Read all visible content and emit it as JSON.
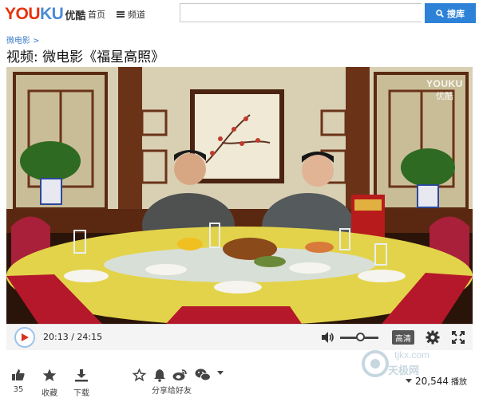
{
  "header": {
    "logo_en_part1": "YOU",
    "logo_en_part2": "KU",
    "logo_cn": "优酷",
    "nav_home": "首页",
    "nav_channel": "频道",
    "search_placeholder": "",
    "search_button": "搜库"
  },
  "breadcrumb": "微电影 >",
  "page_title": "视频: 微电影《福星高照》",
  "player": {
    "watermark_en": "YOUKU",
    "watermark_cn": "优酷",
    "time_current": "20:13",
    "time_total": "24:15",
    "time_display": "20:13 / 24:15",
    "progress": 0.834,
    "volume_level": 0.5,
    "hd_label": "高清"
  },
  "actions": {
    "like_count": "35",
    "collect_label": "收藏",
    "download_label": "下载",
    "share_label": "分享给好友",
    "view_count": "20,544",
    "view_label": "播放"
  },
  "site_watermark": {
    "line1": "tjkx.com",
    "line2": "天极网"
  },
  "icons": [
    "search-icon",
    "play-icon",
    "volume-icon",
    "gear-icon",
    "fullscreen-icon",
    "thumbs-up-icon",
    "star-icon",
    "download-icon",
    "star-outline-icon",
    "bell-icon",
    "weibo-icon",
    "wechat-icon",
    "caret-down-icon"
  ],
  "colors": {
    "brand_red": "#e8320b",
    "brand_blue": "#2d82d8",
    "link_blue": "#3a7cc8"
  }
}
